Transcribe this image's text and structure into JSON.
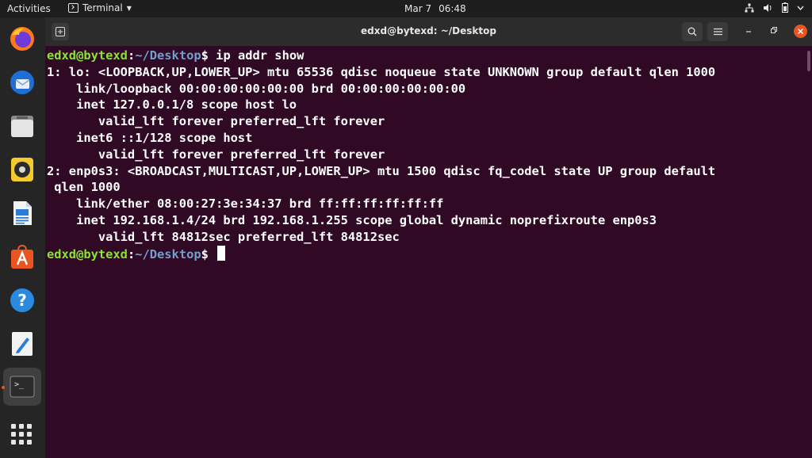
{
  "topbar": {
    "activities": "Activities",
    "app_name": "Terminal",
    "date": "Mar 7",
    "time": "06:48"
  },
  "window": {
    "title": "edxd@bytexd: ~/Desktop"
  },
  "dock": {
    "items": [
      {
        "name": "firefox"
      },
      {
        "name": "thunderbird"
      },
      {
        "name": "files"
      },
      {
        "name": "rhythmbox"
      },
      {
        "name": "libreoffice-writer"
      },
      {
        "name": "software"
      },
      {
        "name": "help"
      },
      {
        "name": "text-editor"
      },
      {
        "name": "terminal"
      }
    ]
  },
  "terminal": {
    "user_host": "edxd@bytexd",
    "path": "~/Desktop",
    "command": " ip addr show",
    "output": [
      "1: lo: <LOOPBACK,UP,LOWER_UP> mtu 65536 qdisc noqueue state UNKNOWN group default qlen 1000",
      "    link/loopback 00:00:00:00:00:00 brd 00:00:00:00:00:00",
      "    inet 127.0.0.1/8 scope host lo",
      "       valid_lft forever preferred_lft forever",
      "    inet6 ::1/128 scope host",
      "       valid_lft forever preferred_lft forever",
      "2: enp0s3: <BROADCAST,MULTICAST,UP,LOWER_UP> mtu 1500 qdisc fq_codel state UP group default",
      " qlen 1000",
      "    link/ether 08:00:27:3e:34:37 brd ff:ff:ff:ff:ff:ff",
      "    inet 192.168.1.4/24 brd 192.168.1.255 scope global dynamic noprefixroute enp0s3",
      "       valid_lft 84812sec preferred_lft 84812sec"
    ]
  }
}
